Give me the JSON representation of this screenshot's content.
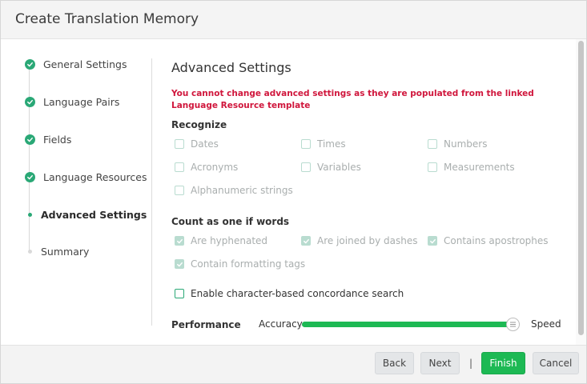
{
  "dialog": {
    "title": "Create Translation Memory"
  },
  "steps": [
    {
      "label": "General Settings",
      "status": "done"
    },
    {
      "label": "Language Pairs",
      "status": "done"
    },
    {
      "label": "Fields",
      "status": "done"
    },
    {
      "label": "Language Resources",
      "status": "done"
    },
    {
      "label": "Advanced Settings",
      "status": "active"
    },
    {
      "label": "Summary",
      "status": "pending"
    }
  ],
  "main": {
    "title": "Advanced Settings",
    "warning": "You cannot change advanced settings as they are populated from the linked Language Resource template",
    "recognize": {
      "label": "Recognize",
      "options": [
        {
          "label": "Dates",
          "checked": false
        },
        {
          "label": "Times",
          "checked": false
        },
        {
          "label": "Numbers",
          "checked": false
        },
        {
          "label": "Acronyms",
          "checked": false
        },
        {
          "label": "Variables",
          "checked": false
        },
        {
          "label": "Measurements",
          "checked": false
        },
        {
          "label": "Alphanumeric strings",
          "checked": false
        }
      ]
    },
    "count_as_one": {
      "label": "Count as one if words",
      "options": [
        {
          "label": "Are hyphenated",
          "checked": true
        },
        {
          "label": "Are joined by dashes",
          "checked": true
        },
        {
          "label": "Contains apostrophes",
          "checked": true
        },
        {
          "label": "Contain formatting tags",
          "checked": true
        }
      ]
    },
    "concordance": {
      "label": "Enable character-based concordance search",
      "checked": false
    },
    "performance": {
      "label": "Performance",
      "left_label": "Accuracy",
      "right_label": "Speed",
      "value_fraction": 1.0
    }
  },
  "footer": {
    "back": "Back",
    "next": "Next",
    "separator": "|",
    "finish": "Finish",
    "cancel": "Cancel"
  },
  "colors": {
    "accent": "#1db954",
    "step_done": "#2aa876",
    "warning": "#d0163c",
    "disabled_checkbox": "#b9dcd0"
  }
}
